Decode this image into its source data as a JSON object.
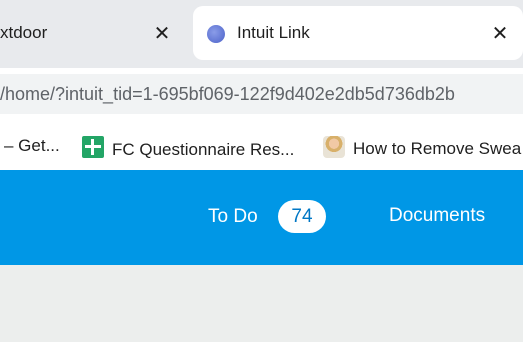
{
  "browser": {
    "tabs": [
      {
        "title": "xtdoor",
        "active": false
      },
      {
        "title": "Intuit Link",
        "active": true
      }
    ],
    "tab_close_glyph": "✕",
    "address_bar": {
      "url": "/home/?intuit_tid=1-695bf069-122f9d402e2db5d736db2b"
    },
    "bookmarks": [
      {
        "label": "– Get...",
        "icon": "none"
      },
      {
        "label": "FC Questionnaire Res...",
        "icon": "google-sheets-icon"
      },
      {
        "label": "How to Remove Swea",
        "icon": "person-thumbnail-icon"
      }
    ]
  },
  "app": {
    "nav": {
      "todo_label": "To Do",
      "todo_count": "74",
      "documents_label": "Documents"
    },
    "colors": {
      "header": "#0097e6",
      "badge_text": "#0077c5",
      "page_bg": "#eceeed"
    }
  }
}
